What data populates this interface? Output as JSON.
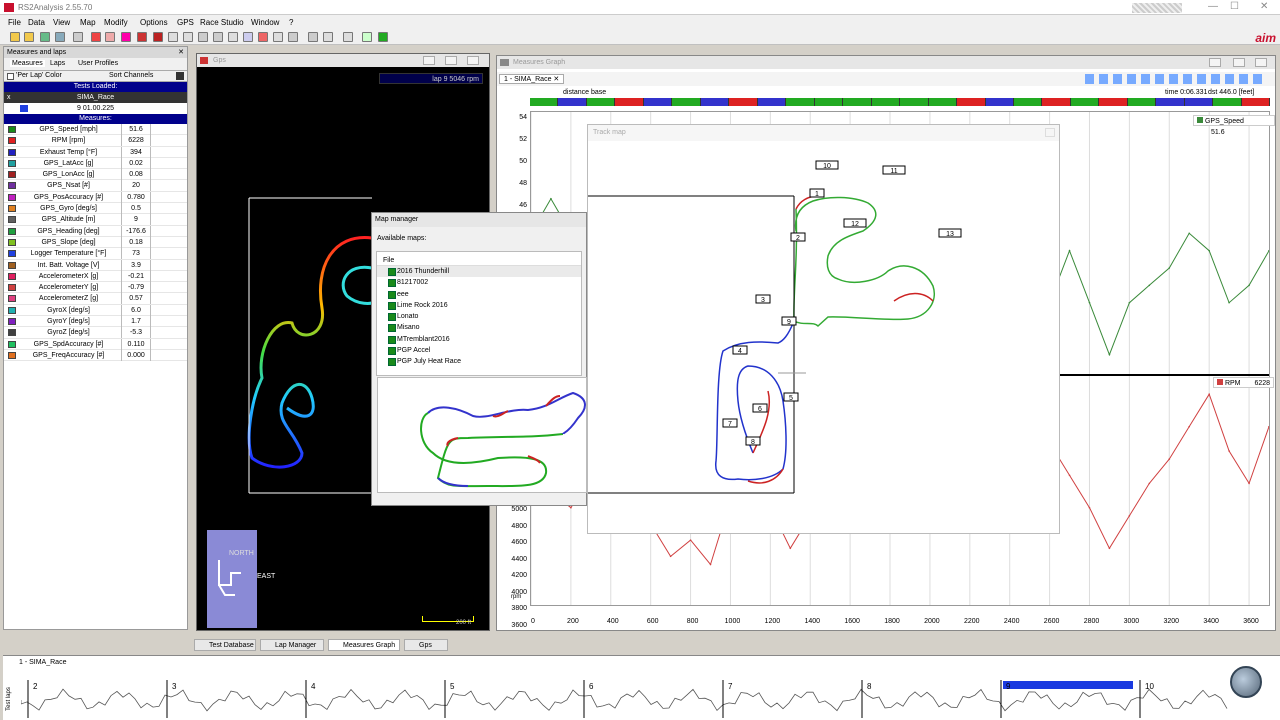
{
  "window": {
    "title": "RS2Analysis 2.55.70",
    "min": "—",
    "max": "☐",
    "close": "✕"
  },
  "menu": [
    "File",
    "Data",
    "View",
    "Map",
    "Modify",
    "Options",
    "GPS",
    "Race Studio",
    "Window",
    "?"
  ],
  "brand": "aim",
  "left_panel": {
    "title": "Measures and laps",
    "tabs": [
      "Measures",
      "Laps",
      "User Profiles"
    ],
    "per_lap_color": "'Per Lap' Color",
    "sort_channels": "Sort Channels",
    "tests_loaded": "Tests Loaded:",
    "test_name": "SIMA_Race",
    "lap_time": "9 01.00.225",
    "measures_header": "Measures:",
    "measures": [
      {
        "name": "GPS_Speed    [mph]",
        "value": "51.6",
        "color": "#1a8a1a"
      },
      {
        "name": "RPM    [rpm]",
        "value": "6228",
        "color": "#e02020"
      },
      {
        "name": "Exhaust Temp    [°F]",
        "value": "394",
        "color": "#2020c0"
      },
      {
        "name": "GPS_LatAcc    [g]",
        "value": "0.02",
        "color": "#20a0a0"
      },
      {
        "name": "GPS_LonAcc    [g]",
        "value": "0.08",
        "color": "#a02020"
      },
      {
        "name": "GPS_Nsat    [#]",
        "value": "20",
        "color": "#7030a0"
      },
      {
        "name": "GPS_PosAccuracy    [#]",
        "value": "0.780",
        "color": "#c020c0"
      },
      {
        "name": "GPS_Gyro    [deg/s]",
        "value": "0.5",
        "color": "#e08020"
      },
      {
        "name": "GPS_Altitude    [m]",
        "value": "9",
        "color": "#606060"
      },
      {
        "name": "GPS_Heading    [deg]",
        "value": "-176.6",
        "color": "#20a040"
      },
      {
        "name": "GPS_Slope    [deg]",
        "value": "0.18",
        "color": "#80c020"
      },
      {
        "name": "Logger Temperature    [°F]",
        "value": "73",
        "color": "#2040e0"
      },
      {
        "name": "Int. Batt. Voltage    [V]",
        "value": "3.9",
        "color": "#a06020"
      },
      {
        "name": "AccelerometerX    [g]",
        "value": "-0.21",
        "color": "#e02060"
      },
      {
        "name": "AccelerometerY    [g]",
        "value": "-0.79",
        "color": "#d04040"
      },
      {
        "name": "AccelerometerZ    [g]",
        "value": "0.57",
        "color": "#e04080"
      },
      {
        "name": "GyroX    [deg/s]",
        "value": "6.0",
        "color": "#20b0b0"
      },
      {
        "name": "GyroY    [deg/s]",
        "value": "1.7",
        "color": "#8020c0"
      },
      {
        "name": "GyroZ    [deg/s]",
        "value": "-5.3",
        "color": "#404040"
      },
      {
        "name": "GPS_SpdAccuracy    [#]",
        "value": "0.110",
        "color": "#20c060"
      },
      {
        "name": "GPS_FreqAccuracy    [#]",
        "value": "0.000",
        "color": "#e07020"
      }
    ]
  },
  "gps_window": {
    "title": "Gps",
    "readout": "lap 9 5046 rpm",
    "compass_north": "NORTH",
    "compass_east": "EAST",
    "scale": "200 ft"
  },
  "map_manager": {
    "title": "Map manager",
    "available": "Available maps:",
    "col_file": "File",
    "maps": [
      "2016 Thunderhill",
      "81217002",
      "eee",
      "Lime Rock 2016",
      "Lonato",
      "Misano",
      "MTremblant2016",
      "PGP Accel",
      "PGP July Heat Race"
    ]
  },
  "track_map": {
    "title": "Track map",
    "turns": [
      "1",
      "2",
      "3",
      "4",
      "5",
      "6",
      "7",
      "8",
      "9",
      "10",
      "11",
      "12",
      "13"
    ]
  },
  "measures_graph": {
    "title": "Measures Graph",
    "tab": "1 - SIMA_Race",
    "distance_base": "distance base",
    "time_readout": "time 0:06.331",
    "dist_readout": "dst 446.0 [feet]",
    "legend_speed": "GPS_Speed",
    "legend_speed_val": "51.6",
    "legend_rpm": "RPM",
    "legend_rpm_val": "6228",
    "speed_unit": "mph",
    "rpm_unit": "rpm"
  },
  "chart_data": {
    "type": "line",
    "x_ticks": [
      "0",
      "200",
      "400",
      "600",
      "800",
      "1000",
      "1200",
      "1400",
      "1600",
      "1800",
      "2000",
      "2200",
      "2400",
      "2600",
      "2800",
      "3000",
      "3200",
      "3400",
      "3600"
    ],
    "speed_ticks": [
      "54",
      "52",
      "50",
      "48",
      "46"
    ],
    "rpm_ticks": [
      "5000",
      "4800",
      "4600",
      "4400",
      "4200",
      "4000",
      "3800",
      "3600"
    ],
    "series": [
      {
        "name": "GPS_Speed",
        "color": "#3a8a3a",
        "ylim": [
          40,
          55
        ],
        "x": [
          0,
          100,
          150,
          200,
          300,
          400,
          500,
          600,
          700,
          800,
          900,
          1000,
          1100,
          1200,
          1300,
          1400,
          1500,
          1600,
          1700,
          1800,
          1900,
          2000,
          2100,
          2200,
          2300,
          2400,
          2500,
          2600,
          2700,
          2800,
          2900,
          3000,
          3100,
          3200,
          3300,
          3400,
          3500,
          3600,
          3700
        ],
        "values": [
          48,
          50,
          49,
          47,
          45,
          46,
          47,
          48,
          44,
          46,
          47,
          45,
          44,
          46,
          47,
          45,
          44,
          46,
          48,
          47,
          45,
          44,
          46,
          45,
          44,
          46,
          45,
          44,
          47,
          44,
          41,
          44,
          45,
          46,
          48,
          47,
          44,
          45,
          47
        ]
      },
      {
        "name": "RPM",
        "color": "#d04040",
        "ylim": [
          3600,
          6400
        ],
        "x": [
          0,
          100,
          200,
          300,
          400,
          500,
          600,
          700,
          800,
          900,
          1000,
          1100,
          1200,
          1300,
          1400,
          1500,
          1600,
          1700,
          1800,
          1900,
          2000,
          2100,
          2200,
          2300,
          2400,
          2500,
          2600,
          2700,
          2800,
          2900,
          3000,
          3100,
          3200,
          3300,
          3400,
          3500,
          3600,
          3700
        ],
        "values": [
          5600,
          5000,
          4800,
          5200,
          5400,
          5000,
          4600,
          4200,
          4400,
          4100,
          4900,
          5400,
          4800,
          4300,
          4700,
          5200,
          5600,
          5300,
          4900,
          4600,
          4800,
          5100,
          5400,
          5000,
          4700,
          5200,
          5600,
          5200,
          4800,
          4300,
          4700,
          5100,
          5400,
          5800,
          6200,
          5500,
          5100,
          5800
        ]
      }
    ]
  },
  "bottom_tabs": [
    "Test Database",
    "Lap Manager",
    "Measures Graph",
    "Gps"
  ],
  "overview": {
    "label": "1 - SIMA_Race",
    "side": "Test laps",
    "laps": [
      "2",
      "3",
      "4",
      "5",
      "6",
      "7",
      "8",
      "9",
      "10"
    ]
  }
}
